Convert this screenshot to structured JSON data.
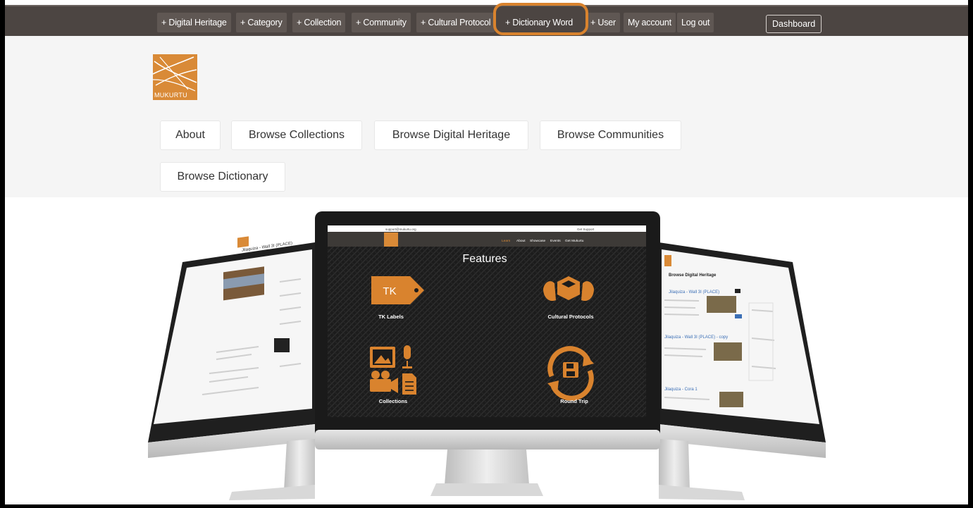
{
  "toolbar": {
    "items": [
      {
        "label": "+ Digital Heritage"
      },
      {
        "label": "+ Category"
      },
      {
        "label": "+ Collection"
      },
      {
        "label": "+ Community"
      },
      {
        "label": "+ Cultural Protocol"
      },
      {
        "label": "+ Dictionary Word"
      },
      {
        "label": "+ User"
      },
      {
        "label": "My account"
      },
      {
        "label": "Log out"
      }
    ],
    "dashboard": "Dashboard"
  },
  "logo": {
    "text": "MUKURTU"
  },
  "nav": {
    "about": "About",
    "browse_collections": "Browse Collections",
    "browse_digital_heritage": "Browse Digital Heritage",
    "browse_communities": "Browse Communities",
    "browse_dictionary": "Browse Dictionary"
  },
  "center_screen": {
    "email": "support@mukurtu.org",
    "get_support": "Get Support",
    "nav": [
      "Learn",
      "About",
      "Showcase",
      "Events",
      "Get Mukurtu"
    ],
    "heading": "Features",
    "tk_badge": "TK",
    "features": [
      "TK Labels",
      "Cultural Protocols",
      "Collections",
      "Round Trip"
    ]
  },
  "right_screen": {
    "title": "Browse Digital Heritage",
    "entries": [
      "Jilaquiza - Wall 3I (PLACE)",
      "Jilaquiza - Wall 3I (PLACE) - copy",
      "Jilaquiza - Cora 1"
    ]
  },
  "left_screen": {
    "title": "Jilaquiza - Wall 3I (PLACE)"
  },
  "colors": {
    "accent": "#d9832e",
    "toolbar": "#4c4542",
    "header_bg": "#f5f5f5"
  }
}
